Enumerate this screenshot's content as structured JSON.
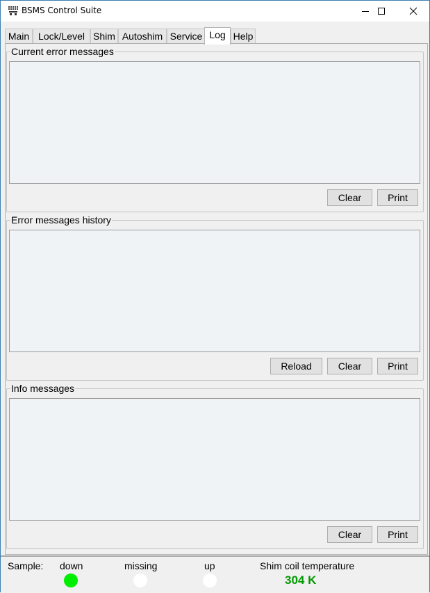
{
  "window": {
    "title": "BSMS Control Suite"
  },
  "tabs": [
    {
      "label": "Main"
    },
    {
      "label": "Lock/Level"
    },
    {
      "label": "Shim"
    },
    {
      "label": "Autoshim"
    },
    {
      "label": "Service"
    },
    {
      "label": "Log",
      "active": true
    },
    {
      "label": "Help"
    }
  ],
  "groups": {
    "current": {
      "title": "Current error messages",
      "clear": "Clear",
      "print": "Print"
    },
    "history": {
      "title": "Error messages history",
      "reload": "Reload",
      "clear": "Clear",
      "print": "Print"
    },
    "info": {
      "title": "Info messages",
      "clear": "Clear",
      "print": "Print"
    }
  },
  "status": {
    "sample_label": "Sample:",
    "down_label": "down",
    "missing_label": "missing",
    "up_label": "up",
    "temp_label": "Shim coil temperature",
    "temp_value": "304 K",
    "colors": {
      "down_led": "#00ee00",
      "missing_led": "#ffffff",
      "up_led": "#ffffff",
      "temp_text": "#009900"
    }
  }
}
